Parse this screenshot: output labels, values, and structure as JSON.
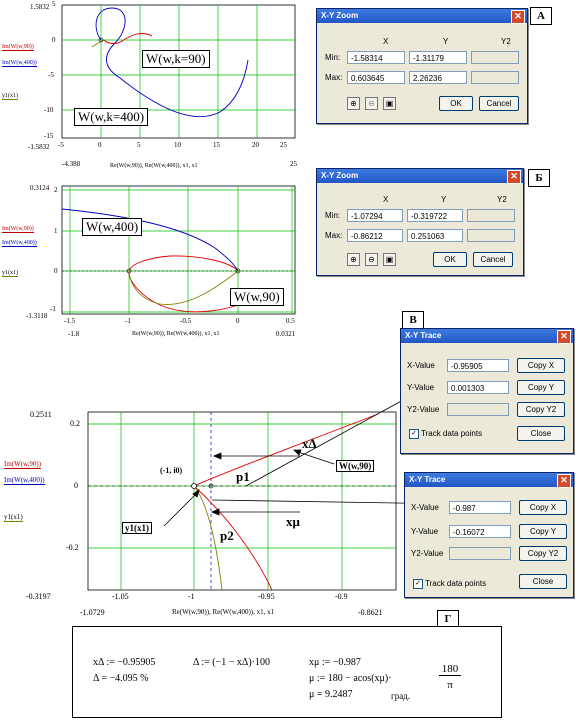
{
  "plot_a": {
    "y_top": "1.5832",
    "y_bottom": "-1.5832",
    "x_left": "-4.388",
    "x_right": "25",
    "ylabel1": "Im(W(w,90))",
    "ylabel2": "Im(W(w,400))",
    "ylabel3": "y1(x1)",
    "xlabel": "Re(W(w,90)), Re(W(w,400)), x1, x1",
    "yticks": [
      "5",
      "0",
      "-5",
      "-10",
      "-15"
    ],
    "xticks": [
      "-5",
      "0",
      "5",
      "10",
      "15",
      "20",
      "25"
    ],
    "callout_top": "W(w,k=90)",
    "callout_bottom": "W(w,k=400)"
  },
  "plot_b": {
    "y_top": "0.3124",
    "y_bottom": "-1.3118",
    "x_left": "-1.8",
    "x_right": "0.0321",
    "ylabel1": "Im(W(w,90))",
    "ylabel2": "Im(W(w,400))",
    "ylabel3": "y1(x1)",
    "xlabel": "Re(W(w,90)), Re(W(w,400)), x1, x1",
    "yticks": [
      "2",
      "1",
      "0",
      "-1"
    ],
    "xticks": [
      "-1.5",
      "-1",
      "-0.5",
      "0",
      "0.5"
    ],
    "callout_top": "W(w,400)",
    "callout_bottom": "W(w,90)"
  },
  "plot_c": {
    "y_top": "0.2511",
    "y_bottom": "-0.3197",
    "x_left": "-1.0729",
    "x_right": "-0.8621",
    "ylabel1": "Im(W(w,90))",
    "ylabel2": "Im(W(w,400))",
    "ylabel3": "y1(x1)",
    "xlabel": "Re(W(w,90)), Re(W(w,400)), x1, x1",
    "yticks": [
      "0.2",
      "0",
      "-0.2"
    ],
    "xticks": [
      "-1.05",
      "-1",
      "-0.95",
      "-0.9"
    ],
    "point_label": "(-1, i0)",
    "series_label": "W(w,90)",
    "y1_label": "y1(x1)",
    "p1": "p1",
    "p2": "p2",
    "xdelta": "xΔ",
    "xmu": "xμ"
  },
  "letters": {
    "a": "А",
    "b": "Б",
    "v": "В",
    "g": "Г"
  },
  "zoom_a": {
    "title": "X-Y Zoom",
    "col_x": "X",
    "col_y": "Y",
    "col_y2": "Y2",
    "min_label": "Min:",
    "max_label": "Max:",
    "min_x": "-1.58314",
    "min_y": "-1.31179",
    "max_x": "0.603645",
    "max_y": "2.26236",
    "ok": "OK",
    "cancel": "Cancel"
  },
  "zoom_b": {
    "title": "X-Y Zoom",
    "col_x": "X",
    "col_y": "Y",
    "col_y2": "Y2",
    "min_label": "Min:",
    "max_label": "Max:",
    "min_x": "-1.07294",
    "min_y": "-0.319722",
    "max_x": "-0.86212",
    "max_y": "0.251063",
    "ok": "OK",
    "cancel": "Cancel"
  },
  "trace_1": {
    "title": "X-Y Trace",
    "xlabel": "X-Value",
    "ylabel": "Y-Value",
    "y2label": "Y2-Value",
    "x": "-0.95905",
    "y": "0.001303",
    "copy_x": "Copy X",
    "copy_y": "Copy Y",
    "copy_y2": "Copy Y2",
    "track": "Track data points",
    "close": "Close"
  },
  "trace_2": {
    "title": "X-Y Trace",
    "xlabel": "X-Value",
    "ylabel": "Y-Value",
    "y2label": "Y2-Value",
    "x": "-0.987",
    "y": "-0.16072",
    "copy_x": "Copy X",
    "copy_y": "Copy Y",
    "copy_y2": "Copy Y2",
    "track": "Track data points",
    "close": "Close"
  },
  "calc": {
    "line1a": "xΔ := −0.95905",
    "line1b": "Δ := (−1 − xΔ)·100",
    "line2": "Δ = −4.095    %",
    "line3": "xμ := −0.987",
    "line4": "μ := 180 − acos(xμ)·",
    "frac_num": "180",
    "frac_den": "π",
    "line5": "μ = 9.2487",
    "unit": "град."
  },
  "colors": {
    "grid": "#00c000",
    "red": "#e00000",
    "blue": "#0000c0",
    "olive": "#808000"
  }
}
